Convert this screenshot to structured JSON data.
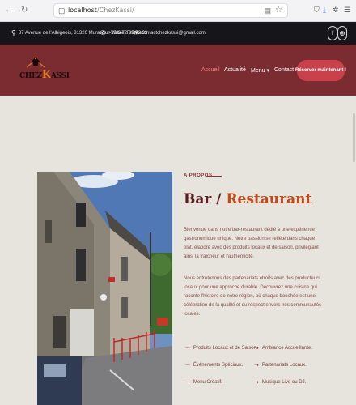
{
  "browser": {
    "url_host": "localhost",
    "url_path": "/ChezKassi/",
    "icons": [
      "back-icon",
      "forward-icon",
      "reload-icon",
      "lock-icon",
      "reader-icon",
      "star-icon",
      "shield-icon",
      "download-icon",
      "extensions-icon",
      "menu-icon"
    ]
  },
  "topbar": {
    "address": "87 Avenue de l'Albigeois, 81320 Murat-sur-Vèbre, France",
    "phone": "+33 6 72 65 73 99",
    "email": "contactchezkassi@gmail.com",
    "social": [
      "f",
      "ig"
    ]
  },
  "header": {
    "logo_text_a": "CHEZ",
    "logo_text_k": "K",
    "logo_text_b": "ASSI",
    "nav": [
      {
        "label": "Accueil",
        "active": true
      },
      {
        "label": "Actualité",
        "active": false
      },
      {
        "label": "Menu ▾",
        "active": false
      },
      {
        "label": "Contact",
        "active": false
      }
    ],
    "cta": "Réserver maintenant !"
  },
  "about": {
    "kicker": "A PROPOS",
    "title_a": "Bar /",
    "title_b": "Restaurant",
    "para1": "Bienvenue dans notre bar-restaurant dédié à une expérience gastronomique unique. Notre passion se reflète dans chaque plat, élaboré avec des produits locaux et de saison, privilégiant ainsi la fraîcheur et l'authenticité.",
    "para2": "Nous entretenons des partenariats étroits avec des producteurs locaux pour une approche durable. Découvrez une cuisine qui raconte l'histoire de notre région, où chaque bouchée est une célébration de la qualité et du respect envers nos communautés locales.",
    "features": [
      "Produits Locaux et de Saison.",
      "Ambiance Accueillante.",
      "Événements Spéciaux.",
      "Partenariats Locaux.",
      "Menu Créatif.",
      "Musique Live ou DJ."
    ]
  },
  "colors": {
    "header_bg": "#7a2c31",
    "topbar_bg": "#16161a",
    "cta_bg": "#c9414a",
    "accent_orange": "#c3491a",
    "page_bg": "#e6e4dd"
  }
}
